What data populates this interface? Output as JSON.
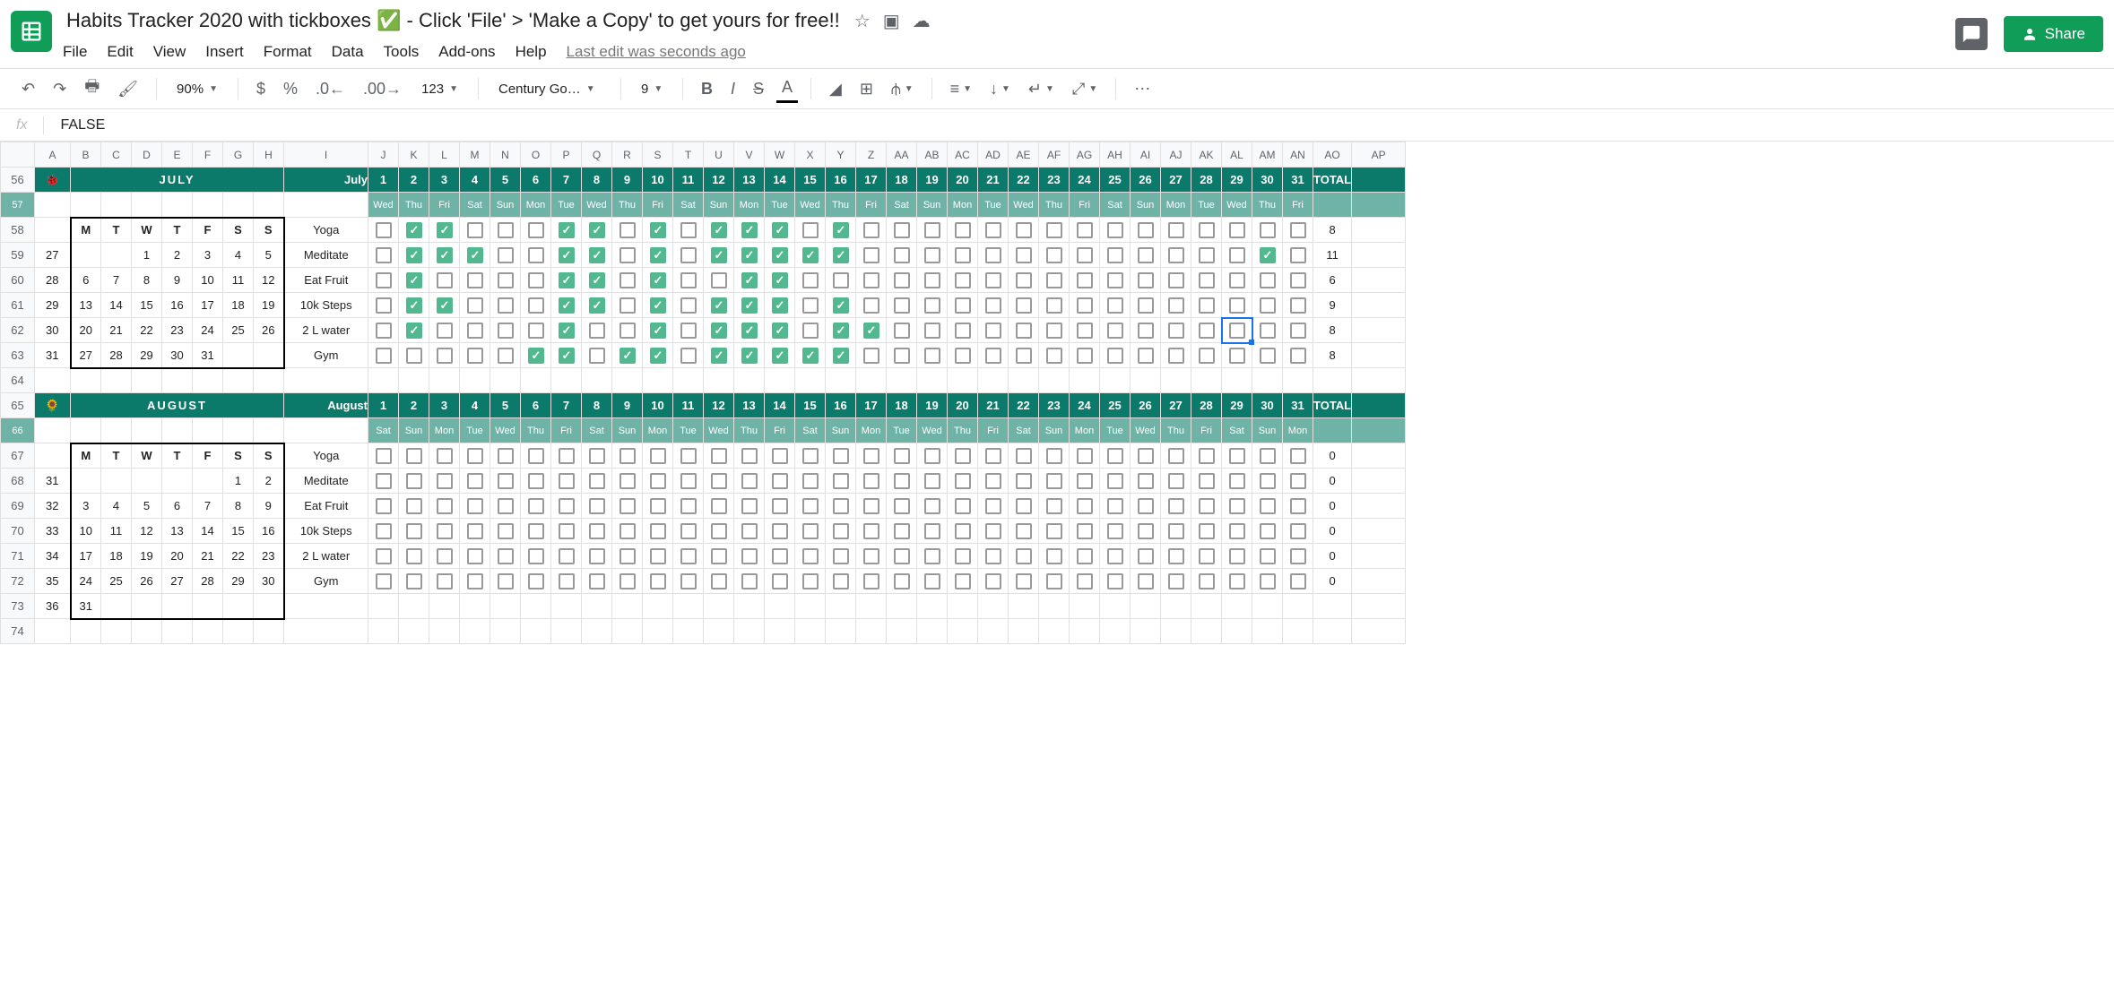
{
  "doc": {
    "title": "Habits Tracker 2020 with tickboxes ✅ - Click 'File' > 'Make a Copy' to get yours for free!!"
  },
  "menu": {
    "file": "File",
    "edit": "Edit",
    "view": "View",
    "insert": "Insert",
    "format": "Format",
    "data": "Data",
    "tools": "Tools",
    "addons": "Add-ons",
    "help": "Help",
    "last_edit": "Last edit was seconds ago"
  },
  "toolbar": {
    "zoom": "90%",
    "font": "Century Go…",
    "size": "9"
  },
  "formula": {
    "value": "FALSE"
  },
  "share": "Share",
  "columns": [
    "A",
    "B",
    "C",
    "D",
    "E",
    "F",
    "G",
    "H",
    "I",
    "J",
    "K",
    "L",
    "M",
    "N",
    "O",
    "P",
    "Q",
    "R",
    "S",
    "T",
    "U",
    "V",
    "W",
    "X",
    "Y",
    "Z",
    "AA",
    "AB",
    "AC",
    "AD",
    "AE",
    "AF",
    "AG",
    "AH",
    "AI",
    "AJ",
    "AK",
    "AL",
    "AM",
    "AN",
    "AO",
    "AP"
  ],
  "rows": [
    56,
    57,
    58,
    59,
    60,
    61,
    62,
    63,
    64,
    65,
    66,
    67,
    68,
    69,
    70,
    71,
    72,
    73,
    74
  ],
  "july": {
    "emoji": "🐞",
    "name": "JULY",
    "label": "July",
    "days": [
      1,
      2,
      3,
      4,
      5,
      6,
      7,
      8,
      9,
      10,
      11,
      12,
      13,
      14,
      15,
      16,
      17,
      18,
      19,
      20,
      21,
      22,
      23,
      24,
      25,
      26,
      27,
      28,
      29,
      30,
      31
    ],
    "dow": [
      "Wed",
      "Thu",
      "Fri",
      "Sat",
      "Sun",
      "Mon",
      "Tue",
      "Wed",
      "Thu",
      "Fri",
      "Sat",
      "Sun",
      "Mon",
      "Tue",
      "Wed",
      "Thu",
      "Fri",
      "Sat",
      "Sun",
      "Mon",
      "Tue",
      "Wed",
      "Thu",
      "Fri",
      "Sat",
      "Sun",
      "Mon",
      "Tue",
      "Wed",
      "Thu",
      "Fri"
    ],
    "total": "TOTAL",
    "cal_header": [
      "M",
      "T",
      "W",
      "T",
      "F",
      "S",
      "S"
    ],
    "cal": [
      [
        "27",
        "",
        "",
        "1",
        "2",
        "3",
        "4",
        "5"
      ],
      [
        "28",
        "6",
        "7",
        "8",
        "9",
        "10",
        "11",
        "12"
      ],
      [
        "29",
        "13",
        "14",
        "15",
        "16",
        "17",
        "18",
        "19"
      ],
      [
        "30",
        "20",
        "21",
        "22",
        "23",
        "24",
        "25",
        "26"
      ],
      [
        "31",
        "27",
        "28",
        "29",
        "30",
        "31",
        "",
        ""
      ]
    ],
    "habits": [
      {
        "name": "Yoga",
        "checks": [
          0,
          1,
          1,
          0,
          0,
          0,
          1,
          1,
          0,
          1,
          0,
          1,
          1,
          1,
          0,
          1,
          0,
          0,
          0,
          0,
          0,
          0,
          0,
          0,
          0,
          0,
          0,
          0,
          0,
          0,
          0
        ],
        "total": 8
      },
      {
        "name": "Meditate",
        "checks": [
          0,
          1,
          1,
          1,
          0,
          0,
          1,
          1,
          0,
          1,
          0,
          1,
          1,
          1,
          1,
          1,
          0,
          0,
          0,
          0,
          0,
          0,
          0,
          0,
          0,
          0,
          0,
          0,
          0,
          1,
          0
        ],
        "total": 11
      },
      {
        "name": "Eat Fruit",
        "checks": [
          0,
          1,
          0,
          0,
          0,
          0,
          1,
          1,
          0,
          1,
          0,
          0,
          1,
          1,
          0,
          0,
          0,
          0,
          0,
          0,
          0,
          0,
          0,
          0,
          0,
          0,
          0,
          0,
          0,
          0,
          0
        ],
        "total": 6
      },
      {
        "name": "10k Steps",
        "checks": [
          0,
          1,
          1,
          0,
          0,
          0,
          1,
          1,
          0,
          1,
          0,
          1,
          1,
          1,
          0,
          1,
          0,
          0,
          0,
          0,
          0,
          0,
          0,
          0,
          0,
          0,
          0,
          0,
          0,
          0,
          0
        ],
        "total": 9
      },
      {
        "name": "2 L water",
        "checks": [
          0,
          1,
          0,
          0,
          0,
          0,
          1,
          0,
          0,
          1,
          0,
          1,
          1,
          1,
          0,
          1,
          1,
          0,
          0,
          0,
          0,
          0,
          0,
          0,
          0,
          0,
          0,
          0,
          0,
          0,
          0
        ],
        "total": 8
      },
      {
        "name": "Gym",
        "checks": [
          0,
          0,
          0,
          0,
          0,
          1,
          1,
          0,
          1,
          1,
          0,
          1,
          1,
          1,
          1,
          1,
          0,
          0,
          0,
          0,
          0,
          0,
          0,
          0,
          0,
          0,
          0,
          0,
          0,
          0,
          0
        ],
        "total": 8
      }
    ]
  },
  "august": {
    "emoji": "🌻",
    "name": "AUGUST",
    "label": "August",
    "days": [
      1,
      2,
      3,
      4,
      5,
      6,
      7,
      8,
      9,
      10,
      11,
      12,
      13,
      14,
      15,
      16,
      17,
      18,
      19,
      20,
      21,
      22,
      23,
      24,
      25,
      26,
      27,
      28,
      29,
      30,
      31
    ],
    "dow": [
      "Sat",
      "Sun",
      "Mon",
      "Tue",
      "Wed",
      "Thu",
      "Fri",
      "Sat",
      "Sun",
      "Mon",
      "Tue",
      "Wed",
      "Thu",
      "Fri",
      "Sat",
      "Sun",
      "Mon",
      "Tue",
      "Wed",
      "Thu",
      "Fri",
      "Sat",
      "Sun",
      "Mon",
      "Tue",
      "Wed",
      "Thu",
      "Fri",
      "Sat",
      "Sun",
      "Mon"
    ],
    "total": "TOTAL",
    "cal_header": [
      "M",
      "T",
      "W",
      "T",
      "F",
      "S",
      "S"
    ],
    "cal": [
      [
        "31",
        "",
        "",
        "",
        "",
        "",
        "1",
        "2"
      ],
      [
        "32",
        "3",
        "4",
        "5",
        "6",
        "7",
        "8",
        "9"
      ],
      [
        "33",
        "10",
        "11",
        "12",
        "13",
        "14",
        "15",
        "16"
      ],
      [
        "34",
        "17",
        "18",
        "19",
        "20",
        "21",
        "22",
        "23"
      ],
      [
        "35",
        "24",
        "25",
        "26",
        "27",
        "28",
        "29",
        "30"
      ],
      [
        "36",
        "31",
        "",
        "",
        "",
        "",
        "",
        ""
      ]
    ],
    "habits": [
      {
        "name": "Yoga",
        "checks": [
          0,
          0,
          0,
          0,
          0,
          0,
          0,
          0,
          0,
          0,
          0,
          0,
          0,
          0,
          0,
          0,
          0,
          0,
          0,
          0,
          0,
          0,
          0,
          0,
          0,
          0,
          0,
          0,
          0,
          0,
          0
        ],
        "total": 0
      },
      {
        "name": "Meditate",
        "checks": [
          0,
          0,
          0,
          0,
          0,
          0,
          0,
          0,
          0,
          0,
          0,
          0,
          0,
          0,
          0,
          0,
          0,
          0,
          0,
          0,
          0,
          0,
          0,
          0,
          0,
          0,
          0,
          0,
          0,
          0,
          0
        ],
        "total": 0
      },
      {
        "name": "Eat Fruit",
        "checks": [
          0,
          0,
          0,
          0,
          0,
          0,
          0,
          0,
          0,
          0,
          0,
          0,
          0,
          0,
          0,
          0,
          0,
          0,
          0,
          0,
          0,
          0,
          0,
          0,
          0,
          0,
          0,
          0,
          0,
          0,
          0
        ],
        "total": 0
      },
      {
        "name": "10k Steps",
        "checks": [
          0,
          0,
          0,
          0,
          0,
          0,
          0,
          0,
          0,
          0,
          0,
          0,
          0,
          0,
          0,
          0,
          0,
          0,
          0,
          0,
          0,
          0,
          0,
          0,
          0,
          0,
          0,
          0,
          0,
          0,
          0
        ],
        "total": 0
      },
      {
        "name": "2 L water",
        "checks": [
          0,
          0,
          0,
          0,
          0,
          0,
          0,
          0,
          0,
          0,
          0,
          0,
          0,
          0,
          0,
          0,
          0,
          0,
          0,
          0,
          0,
          0,
          0,
          0,
          0,
          0,
          0,
          0,
          0,
          0,
          0
        ],
        "total": 0
      },
      {
        "name": "Gym",
        "checks": [
          0,
          0,
          0,
          0,
          0,
          0,
          0,
          0,
          0,
          0,
          0,
          0,
          0,
          0,
          0,
          0,
          0,
          0,
          0,
          0,
          0,
          0,
          0,
          0,
          0,
          0,
          0,
          0,
          0,
          0,
          0
        ],
        "total": 0
      }
    ]
  },
  "selected_cell": {
    "row": 62,
    "col": "AL"
  }
}
